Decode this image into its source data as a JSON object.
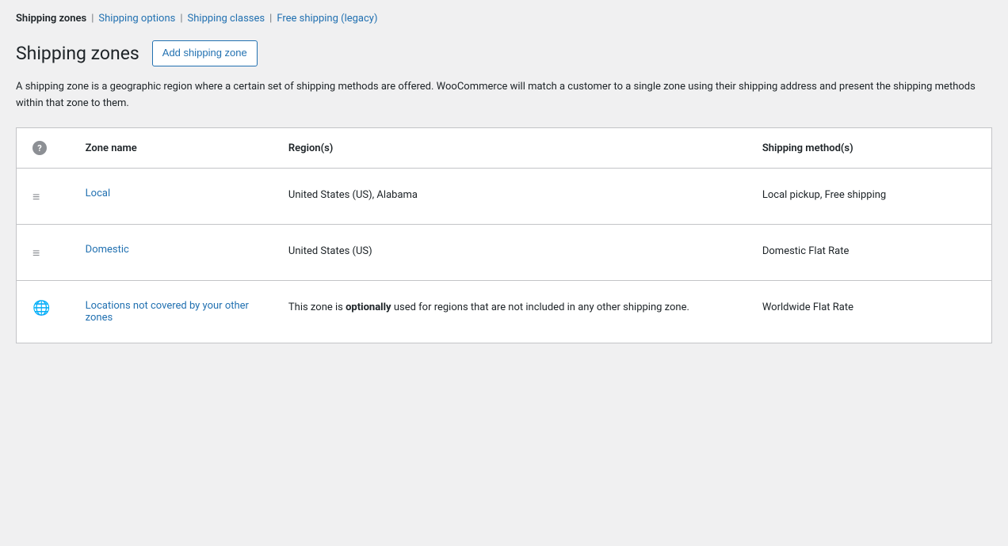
{
  "nav": {
    "current": "Shipping zones",
    "separator1": "|",
    "link1_label": "Shipping options",
    "link2_separator": "|",
    "link2_label": "Shipping classes",
    "link3_separator": "|",
    "link3_label": "Free shipping (legacy)"
  },
  "page": {
    "title": "Shipping zones",
    "add_button": "Add shipping zone",
    "description": "A shipping zone is a geographic region where a certain set of shipping methods are offered. WooCommerce will match a customer to a single zone using their shipping address and present the shipping methods within that zone to them."
  },
  "table": {
    "col_icon": "?",
    "col_zone": "Zone name",
    "col_region": "Region(s)",
    "col_method": "Shipping method(s)",
    "rows": [
      {
        "drag_icon": "≡",
        "zone_name": "Local",
        "region": "United States (US), Alabama",
        "method": "Local pickup, Free shipping"
      },
      {
        "drag_icon": "≡",
        "zone_name": "Domestic",
        "region": "United States (US)",
        "method": "Domestic Flat Rate"
      },
      {
        "drag_icon": "globe",
        "zone_name": "Locations not covered by your other zones",
        "region_prefix": "This zone is ",
        "region_bold": "optionally",
        "region_suffix": " used for regions that are not included in any other shipping zone.",
        "method": "Worldwide Flat Rate"
      }
    ]
  }
}
